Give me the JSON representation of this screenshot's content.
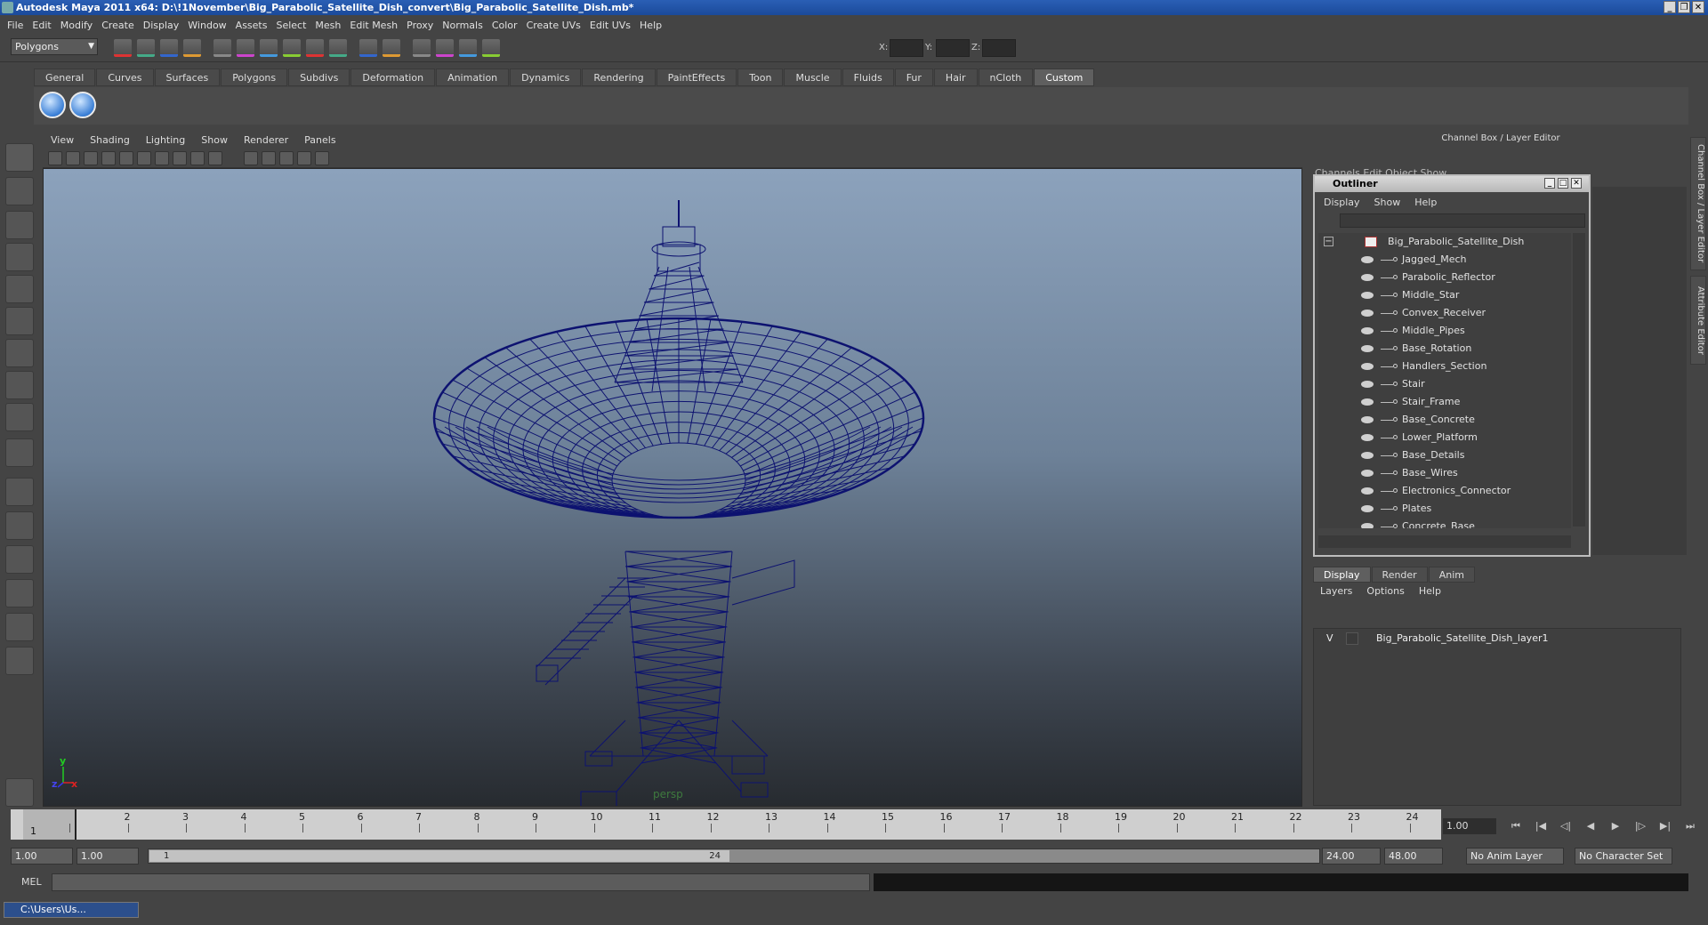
{
  "window": {
    "title": "Autodesk Maya 2011 x64: D:\\!1November\\Big_Parabolic_Satellite_Dish_convert\\Big_Parabolic_Satellite_Dish.mb*",
    "minimize": "_",
    "maximize": "❐",
    "close": "✕"
  },
  "menubar": [
    "File",
    "Edit",
    "Modify",
    "Create",
    "Display",
    "Window",
    "Assets",
    "Select",
    "Mesh",
    "Edit Mesh",
    "Proxy",
    "Normals",
    "Color",
    "Create UVs",
    "Edit UVs",
    "Help"
  ],
  "statusline": {
    "mode": "Polygons",
    "x_label": "X:",
    "y_label": "Y:",
    "z_label": "Z:"
  },
  "shelf": {
    "tabs": [
      "General",
      "Curves",
      "Surfaces",
      "Polygons",
      "Subdivs",
      "Deformation",
      "Animation",
      "Dynamics",
      "Rendering",
      "PaintEffects",
      "Toon",
      "Muscle",
      "Fluids",
      "Fur",
      "Hair",
      "nCloth",
      "Custom"
    ],
    "active_tab": "Custom"
  },
  "viewport": {
    "menu": [
      "View",
      "Shading",
      "Lighting",
      "Show",
      "Renderer",
      "Panels"
    ],
    "camera": "persp",
    "axis_y": "y",
    "axis_x": "x",
    "axis_z": "z",
    "wire_color": "#0d1270"
  },
  "channel_box": {
    "title": "Channel Box / Layer Editor",
    "menu": "Channels   Edit   Object   Show"
  },
  "outliner": {
    "title": "Outliner",
    "menu": [
      "Display",
      "Show",
      "Help"
    ],
    "root": "Big_Parabolic_Satellite_Dish",
    "items": [
      "Jagged_Mech",
      "Parabolic_Reflector",
      "Middle_Star",
      "Convex_Receiver",
      "Middle_Pipes",
      "Base_Rotation",
      "Handlers_Section",
      "Stair",
      "Stair_Frame",
      "Base_Concrete",
      "Lower_Platform",
      "Base_Details",
      "Base_Wires",
      "Electronics_Connector",
      "Plates",
      "Concrete_Base"
    ]
  },
  "layer_editor": {
    "tabs": [
      "Display",
      "Render",
      "Anim"
    ],
    "active_tab": "Display",
    "menu": [
      "Layers",
      "Options",
      "Help"
    ],
    "layer_visible": "V",
    "layer_name": "Big_Parabolic_Satellite_Dish_layer1"
  },
  "side_tabs": [
    "Channel Box / Layer Editor",
    "Attribute Editor"
  ],
  "timeline": {
    "ticks": [
      "1",
      "2",
      "3",
      "4",
      "5",
      "6",
      "7",
      "8",
      "9",
      "10",
      "11",
      "12",
      "13",
      "14",
      "15",
      "16",
      "17",
      "18",
      "19",
      "20",
      "21",
      "22",
      "23",
      "24"
    ],
    "current_frame_marker": "1",
    "current_time": "1.00"
  },
  "range": {
    "start_time": "1.00",
    "playback_start": "1.00",
    "range_start": "1",
    "range_end": "24",
    "playback_end": "24.00",
    "end_time": "48.00",
    "anim_layer": "No Anim Layer",
    "char_set": "No Character Set"
  },
  "command": {
    "label": "MEL"
  },
  "taskbar": {
    "item": "C:\\Users\\Us..."
  }
}
